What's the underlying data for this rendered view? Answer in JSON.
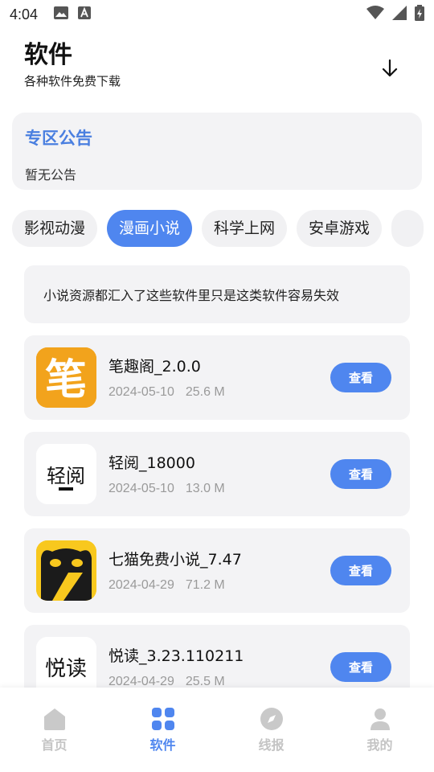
{
  "status_bar": {
    "time": "4:04"
  },
  "header": {
    "title": "软件",
    "subtitle": "各种软件免费下载"
  },
  "notice": {
    "title": "专区公告",
    "body": "暂无公告"
  },
  "categories": [
    {
      "label": "影视动漫",
      "active": false
    },
    {
      "label": "漫画小说",
      "active": true
    },
    {
      "label": "科学上网",
      "active": false
    },
    {
      "label": "安卓游戏",
      "active": false
    }
  ],
  "description": "小说资源都汇入了这些软件里只是这类软件容易失效",
  "apps": [
    {
      "name": "笔趣阁_2.0.0",
      "date": "2024-05-10",
      "size": "25.6 M",
      "button": "查看",
      "icon_text": "笔"
    },
    {
      "name": "轻阅_18000",
      "date": "2024-05-10",
      "size": "13.0 M",
      "button": "查看",
      "icon_text": "轻阅"
    },
    {
      "name": "七猫免费小说_7.47",
      "date": "2024-04-29",
      "size": "71.2 M",
      "button": "查看",
      "icon_text": ""
    },
    {
      "name": "悦读_3.23.110211",
      "date": "2024-04-29",
      "size": "25.5 M",
      "button": "查看",
      "icon_text": "悦读"
    }
  ],
  "nav": [
    {
      "label": "首页",
      "icon": "home-icon",
      "active": false
    },
    {
      "label": "软件",
      "icon": "grid-icon",
      "active": true
    },
    {
      "label": "线报",
      "icon": "compass-icon",
      "active": false
    },
    {
      "label": "我的",
      "icon": "user-icon",
      "active": false
    }
  ],
  "colors": {
    "accent": "#4f86ef",
    "notice_title": "#4a7fe0",
    "card_bg": "#f3f3f5"
  }
}
